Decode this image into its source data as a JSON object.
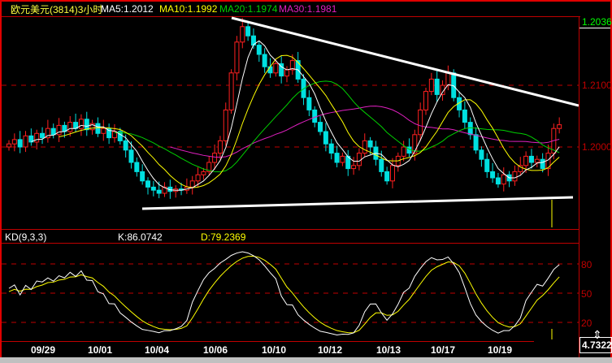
{
  "header": {
    "symbol": "欧元美元(3814)3小时",
    "ma5": "MA5:1.2012",
    "ma10": "MA10:1.1992",
    "ma20": "MA20:1.1974",
    "ma30": "MA30:1.1981"
  },
  "price_axis": {
    "current": "1.2036",
    "labels": [
      "1.2100",
      "1.2000"
    ]
  },
  "kd": {
    "title": "KD(9,3,3)",
    "k": "K:86.0742",
    "d": "D:79.2369",
    "labels": [
      "80",
      "50",
      "20"
    ]
  },
  "dates": [
    "09/29",
    "10/01",
    "10/04",
    "10/06",
    "10/10",
    "10/12",
    "10/13",
    "10/17",
    "10/19"
  ],
  "cursor_value": "4.7322",
  "colors": {
    "up": "#ff2020",
    "down": "#00e0e0",
    "ma5": "#ffffff",
    "ma10": "#ffff00",
    "ma20": "#00d000",
    "ma30": "#e020c0",
    "grid": "#c00000"
  },
  "closes": [
    1.2005,
    1.2012,
    1.2,
    1.2018,
    1.2008,
    1.2022,
    1.2015,
    1.203,
    1.202,
    1.2035,
    1.2025,
    1.204,
    1.203,
    1.2045,
    1.2028,
    1.2038,
    1.2022,
    1.203,
    1.2015,
    1.2025,
    1.201,
    1.1995,
    1.1975,
    1.196,
    1.1945,
    1.1935,
    1.193,
    1.1925,
    1.1935,
    1.1928,
    1.1932,
    1.193,
    1.1935,
    1.1945,
    1.1955,
    1.196,
    1.1975,
    1.199,
    1.201,
    1.206,
    1.212,
    1.217,
    1.2195,
    1.218,
    1.2165,
    1.215,
    1.213,
    1.212,
    1.2135,
    1.2115,
    1.2125,
    1.214,
    1.211,
    1.208,
    1.206,
    1.204,
    1.2025,
    1.2005,
    1.199,
    1.1975,
    1.1985,
    1.1965,
    1.197,
    1.199,
    1.201,
    1.2,
    1.198,
    1.196,
    1.1945,
    1.197,
    1.1985,
    1.2,
    1.199,
    1.202,
    1.206,
    1.209,
    1.211,
    1.2085,
    1.21,
    1.212,
    1.208,
    1.206,
    1.204,
    1.202,
    1.1995,
    1.198,
    1.196,
    1.195,
    1.194,
    1.1955,
    1.1945,
    1.196,
    1.197,
    1.1985,
    1.1975,
    1.198,
    1.1965,
    1.199,
    1.203,
    1.2036
  ]
}
